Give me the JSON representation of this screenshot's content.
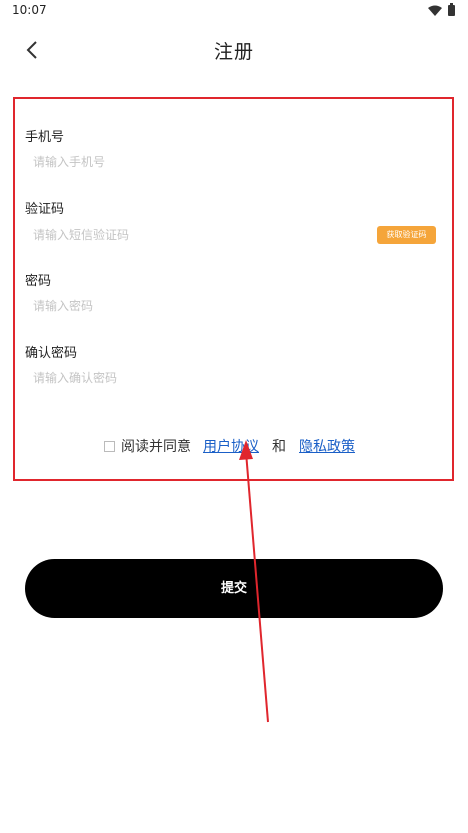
{
  "status_bar": {
    "time": "10:07",
    "wifi_icon": "wifi-icon",
    "battery_icon": "battery-icon"
  },
  "header": {
    "back_icon": "chevron-left-icon",
    "title": "注册"
  },
  "form": {
    "phone": {
      "label": "手机号",
      "placeholder": "请输入手机号",
      "value": ""
    },
    "code": {
      "label": "验证码",
      "placeholder": "请输入短信验证码",
      "value": "",
      "button_label": "获取验证码"
    },
    "password": {
      "label": "密码",
      "placeholder": "请输入密码",
      "value": ""
    },
    "confirm_password": {
      "label": "确认密码",
      "placeholder": "请输入确认密码",
      "value": ""
    },
    "agreement": {
      "checked": false,
      "prefix": "阅读并同意",
      "user_agreement": "用户协议",
      "conjunction": "和",
      "privacy_policy": "隐私政策"
    }
  },
  "submit_label": "提交",
  "colors": {
    "annotation_red": "#e0262d",
    "code_button": "#f5a53a",
    "link": "#1a5fc7",
    "submit_bg": "#000000"
  }
}
